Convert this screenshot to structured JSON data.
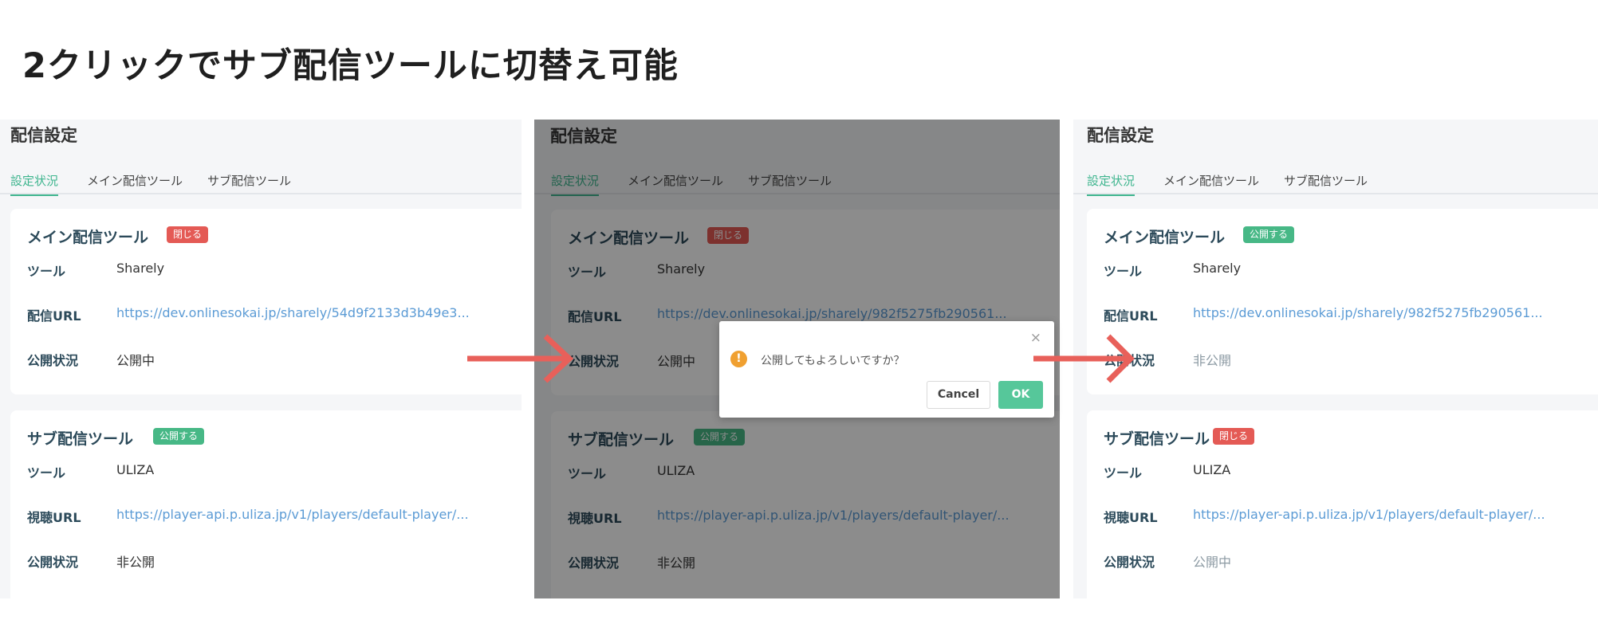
{
  "page_title": "2クリックでサブ配信ツールに切替え可能",
  "colors": {
    "accent": "#3eb58e",
    "badge_close": "#e45a55",
    "badge_publish": "#47b886",
    "arrow": "#e8605a",
    "link": "#5b9bd5"
  },
  "panels": [
    {
      "title": "配信設定",
      "tabs": [
        "設定状況",
        "メイン配信ツール",
        "サブ配信ツール"
      ],
      "main": {
        "title": "メイン配信ツール",
        "badge": "閉じる",
        "tool_label": "ツール",
        "tool": "Sharely",
        "url_label": "配信URL",
        "url": "https://dev.onlinesokai.jp/sharely/54d9f2133d3b49e3...",
        "status_label": "公開状況",
        "status": "公開中"
      },
      "sub": {
        "title": "サブ配信ツール",
        "badge": "公開する",
        "tool_label": "ツール",
        "tool": "ULIZA",
        "url_label": "視聴URL",
        "url": "https://player-api.p.uliza.jp/v1/players/default-player/...",
        "status_label": "公開状況",
        "status": "非公開"
      }
    },
    {
      "title": "配信設定",
      "tabs": [
        "設定状況",
        "メイン配信ツール",
        "サブ配信ツール"
      ],
      "main": {
        "title": "メイン配信ツール",
        "badge": "閉じる",
        "tool_label": "ツール",
        "tool": "Sharely",
        "url_label": "配信URL",
        "url": "https://dev.onlinesokai.jp/sharely/982f5275fb290561...",
        "status_label": "公開状況",
        "status": "公開中"
      },
      "sub": {
        "title": "サブ配信ツール",
        "badge": "公開する",
        "tool_label": "ツール",
        "tool": "ULIZA",
        "url_label": "視聴URL",
        "url": "https://player-api.p.uliza.jp/v1/players/default-player/...",
        "status_label": "公開状況",
        "status": "非公開"
      }
    },
    {
      "title": "配信設定",
      "tabs": [
        "設定状況",
        "メイン配信ツール",
        "サブ配信ツール"
      ],
      "main": {
        "title": "メイン配信ツール",
        "badge": "公開する",
        "tool_label": "ツール",
        "tool": "Sharely",
        "url_label": "配信URL",
        "url": "https://dev.onlinesokai.jp/sharely/982f5275fb290561...",
        "status_label": "公開状況",
        "status": "非公開"
      },
      "sub": {
        "title": "サブ配信ツール",
        "badge": "閉じる",
        "tool_label": "ツール",
        "tool": "ULIZA",
        "url_label": "視聴URL",
        "url": "https://player-api.p.uliza.jp/v1/players/default-player/...",
        "status_label": "公開状況",
        "status": "公開中"
      }
    }
  ],
  "dialog": {
    "message": "公開してもよろしいですか？",
    "icon": "warning-icon",
    "close_icon": "×",
    "cancel_label": "Cancel",
    "ok_label": "OK"
  }
}
